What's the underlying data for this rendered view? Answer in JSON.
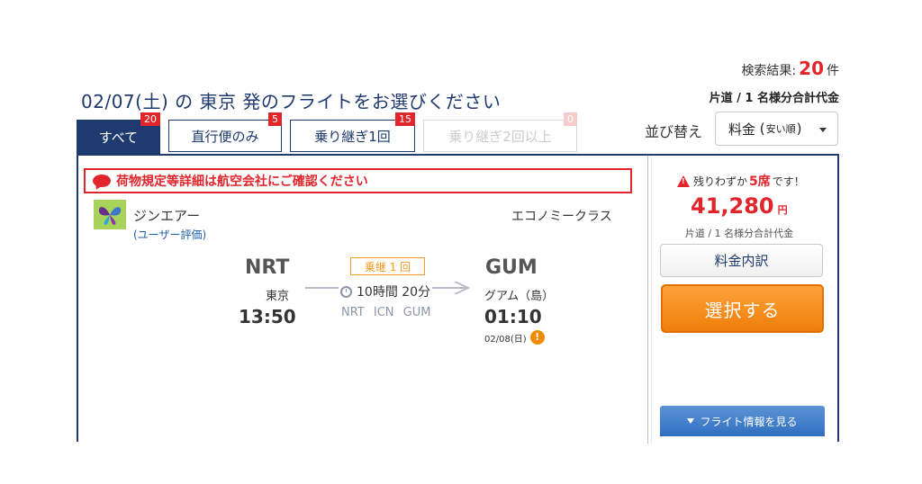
{
  "header": {
    "results_label": "検索結果:",
    "results_count": "20",
    "results_unit": "件",
    "title": "02/07(土) の 東京 発のフライトをお選びください",
    "price_note": "片道 / 1 名様分合計代金"
  },
  "tabs": [
    {
      "label": "すべて",
      "count": "20",
      "active": true
    },
    {
      "label": "直行便のみ",
      "count": "5"
    },
    {
      "label": "乗り継ぎ1回",
      "count": "15"
    },
    {
      "label": "乗り継ぎ2回以上",
      "count": "0",
      "disabled": true
    }
  ],
  "sort": {
    "label": "並び替え",
    "value_main": "料金",
    "value_paren_open": "(",
    "value_sub": "安い順",
    "value_paren_close": ")"
  },
  "card": {
    "baggage_notice": "荷物規定等詳細は航空会社にご確認ください",
    "airline_name": "ジンエアー",
    "user_rating": "(ユーザー評価)",
    "cabin_class": "エコノミークラス",
    "stop_badge": "乗継 1 回",
    "duration": "10時間 20分",
    "via": "NRT ICN GUM",
    "departure": {
      "code": "NRT",
      "city": "東京",
      "time": "13:50"
    },
    "arrival": {
      "code": "GUM",
      "city": "グアム（島）",
      "time": "01:10",
      "date": "02/08(日)"
    },
    "warn_glyph": "!",
    "seats_prefix": "残りわずか",
    "seats_count": "5席",
    "seats_suffix": "です！",
    "price": "41,280",
    "price_unit": "円",
    "price_sub": "片道 / 1 名様分合計代金",
    "breakdown_button": "料金内訳",
    "select_button": "選択する",
    "flight_info_button": "フライト情報を見る"
  },
  "colors": {
    "navy": "#1f3a6e",
    "red": "#e0252b",
    "orange": "#f07f0a",
    "blue_button": "#2f6fc0",
    "logo_green": "#a8d35a"
  },
  "icons": [
    "speech-bubble-icon",
    "airline-butterfly-logo",
    "clock-icon",
    "route-arrow-icon",
    "warning-circle-icon",
    "warning-triangle-icon",
    "caret-down-icon"
  ]
}
